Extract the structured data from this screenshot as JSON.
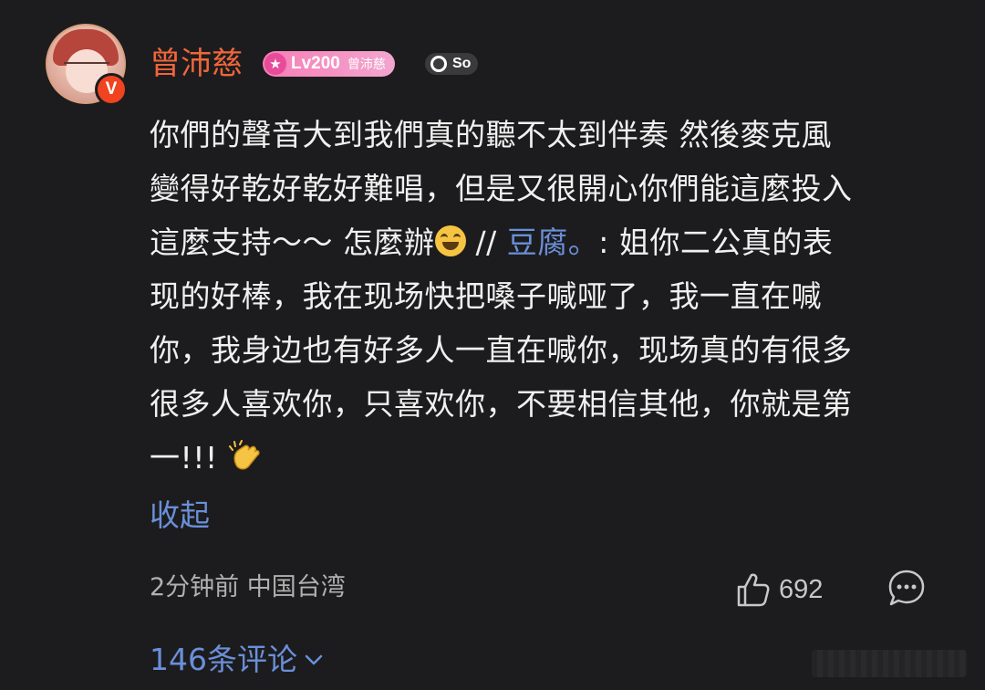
{
  "user": {
    "name": "曾沛慈",
    "verified_mark": "V",
    "level": "Lv200",
    "level_name": "曾沛慈",
    "fan_badge": "So"
  },
  "comment": {
    "line1": "你們的聲音大到我們真的聽不太到伴奏 然後麥克風",
    "line2": "變得好乾好乾好難唱，但是又很開心你們能這麼投入",
    "line3_a": "這麼支持～～ 怎麼辦",
    "line3_sep": " // ",
    "mention": "豆腐。",
    "line3_b": ": 姐你二公真的表",
    "line4": "现的好棒，我在现场快把嗓子喊哑了，我一直在喊",
    "line5": "你，我身边也有好多人一直在喊你，现场真的有很多",
    "line6": "很多人喜欢你，只喜欢你，不要相信其他，你就是第",
    "line7": "一!!! "
  },
  "actions": {
    "collapse_label": "收起",
    "time_location": "2分钟前 中国台湾",
    "like_count": "692",
    "replies_label": "146条评论"
  },
  "colors": {
    "background": "#1c1c1e",
    "username": "#f0663a",
    "link": "#6b8fd8",
    "level_badge": "#f77eb6",
    "verify_badge": "#f0431f"
  },
  "icons": {
    "laugh": "grinning-squinting-face-icon",
    "clap": "clapping-hands-icon",
    "like": "thumbs-up-icon",
    "comment": "comment-bubble-icon",
    "chevron": "chevron-down-icon"
  }
}
